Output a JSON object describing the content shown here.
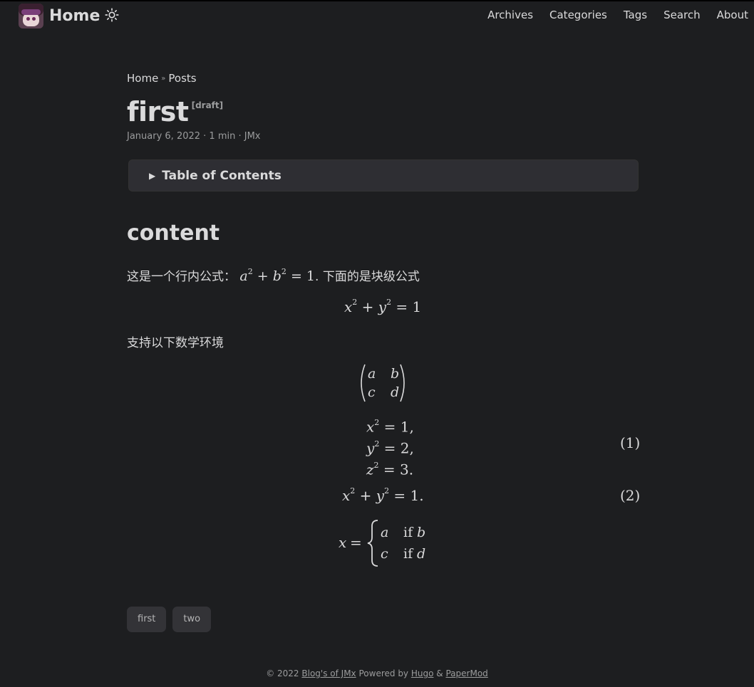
{
  "header": {
    "logo_text": "Home",
    "theme_icon": "sun-icon",
    "menu": [
      "Archives",
      "Categories",
      "Tags",
      "Search",
      "About"
    ]
  },
  "breadcrumbs": [
    "Home",
    "Posts"
  ],
  "post": {
    "title": "first",
    "draft_label": "[draft]",
    "meta": "January 6, 2022 · 1 min · JMx"
  },
  "toc": {
    "label": "Table of Contents"
  },
  "content": {
    "heading": "content",
    "para1_prefix": "这是一个行内公式：",
    "para1_suffix": ". 下面的是块级公式",
    "para2": "支持以下数学环境",
    "eq_numbers": [
      "(1)",
      "(2)"
    ]
  },
  "tags": [
    "first",
    "two"
  ],
  "footer": {
    "copyright": "© 2022",
    "blog_name": "Blog's of JMx",
    "powered_by": "Powered by",
    "hugo": "Hugo",
    "amp": "&",
    "papermod": "PaperMod"
  },
  "colors": {
    "background": "#1d1e20",
    "text": "#dadadb",
    "secondary": "#9b9c9d",
    "toc_bg": "#2e2e33",
    "tag_bg": "#333337"
  }
}
